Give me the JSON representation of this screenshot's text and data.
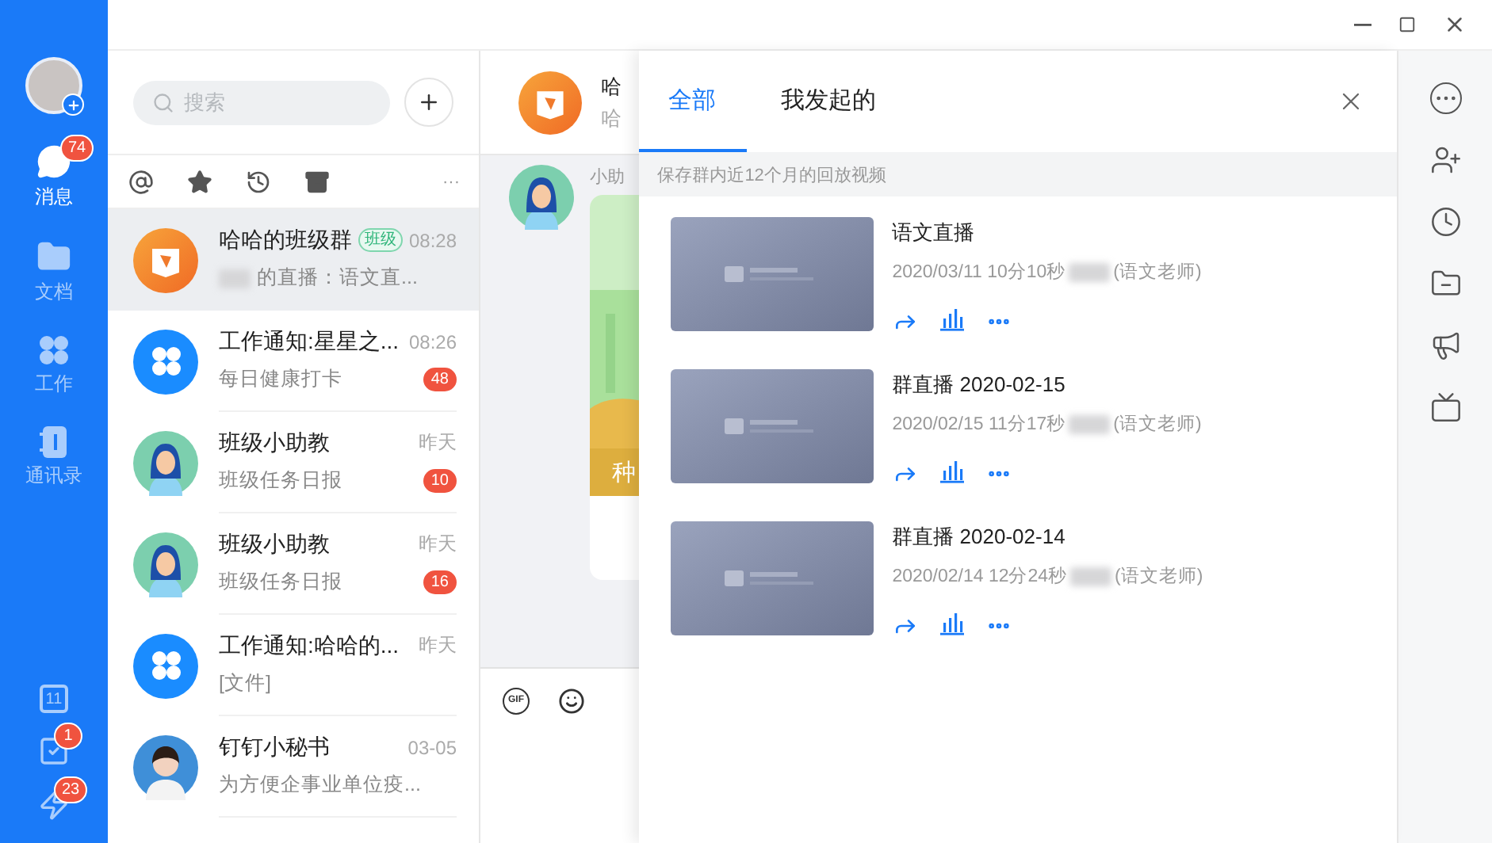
{
  "nav": {
    "items": [
      {
        "kind": "chat",
        "label": "消息",
        "selected": true,
        "badge": "74"
      },
      {
        "kind": "docs",
        "label": "文档",
        "selected": false
      },
      {
        "kind": "work",
        "label": "工作",
        "selected": false
      },
      {
        "kind": "contacts",
        "label": "通讯录",
        "selected": false
      }
    ],
    "bottom": [
      {
        "kind": "calendar",
        "day": "11"
      },
      {
        "kind": "todo",
        "badge": "1"
      },
      {
        "kind": "ding",
        "badge": "23"
      }
    ]
  },
  "search": {
    "placeholder": "搜索"
  },
  "filters": [
    {
      "kind": "at"
    },
    {
      "kind": "star"
    },
    {
      "kind": "recent"
    },
    {
      "kind": "archive"
    },
    {
      "kind": "more",
      "label": "···"
    }
  ],
  "chats": [
    {
      "kind": "book",
      "name": "哈哈的班级群",
      "tag": "班级",
      "time": "08:28",
      "preview": "的直播：语文直...",
      "redacted": true,
      "selected": true
    },
    {
      "kind": "clover",
      "name": "工作通知:星星之...",
      "time": "08:26",
      "preview": "每日健康打卡",
      "badge": "48",
      "redacted": false,
      "selected": false
    },
    {
      "kind": "figure",
      "name": "班级小助教",
      "time": "昨天",
      "preview": "班级任务日报",
      "badge": "10",
      "redacted": false,
      "selected": false
    },
    {
      "kind": "figure",
      "name": "班级小助教",
      "time": "昨天",
      "preview": "班级任务日报",
      "badge": "16",
      "redacted": false,
      "selected": false
    },
    {
      "kind": "clover",
      "name": "工作通知:哈哈的...",
      "time": "昨天",
      "preview": "[文件]",
      "redacted": false,
      "selected": false
    },
    {
      "kind": "person",
      "name": "钉钉小秘书",
      "time": "03-05",
      "preview": "为方便企事业单位疫...",
      "redacted": false,
      "selected": false
    }
  ],
  "conversation": {
    "title": "哈",
    "subtitle": "哈",
    "sender": "小助",
    "card_text": "种",
    "tools": [
      {
        "kind": "gif",
        "label": "GIF"
      },
      {
        "kind": "emoji"
      }
    ]
  },
  "panel": {
    "tabs": [
      {
        "label": "全部",
        "selected": true
      },
      {
        "label": "我发起的",
        "selected": false
      }
    ],
    "notice": "保存群内近12个月的回放视频",
    "videos": [
      {
        "title": "语文直播",
        "meta": "2020/03/11 10分10秒",
        "role": "(语文老师)",
        "redacted": true
      },
      {
        "title": "群直播 2020-02-15",
        "meta": "2020/02/15 11分17秒",
        "role": "(语文老师)",
        "redacted": true
      },
      {
        "title": "群直播 2020-02-14",
        "meta": "2020/02/14 12分24秒",
        "role": "(语文老师)",
        "redacted": true
      }
    ]
  },
  "side_tools": [
    {
      "kind": "more"
    },
    {
      "kind": "add-member"
    },
    {
      "kind": "history"
    },
    {
      "kind": "files"
    },
    {
      "kind": "announce"
    },
    {
      "kind": "live"
    }
  ]
}
